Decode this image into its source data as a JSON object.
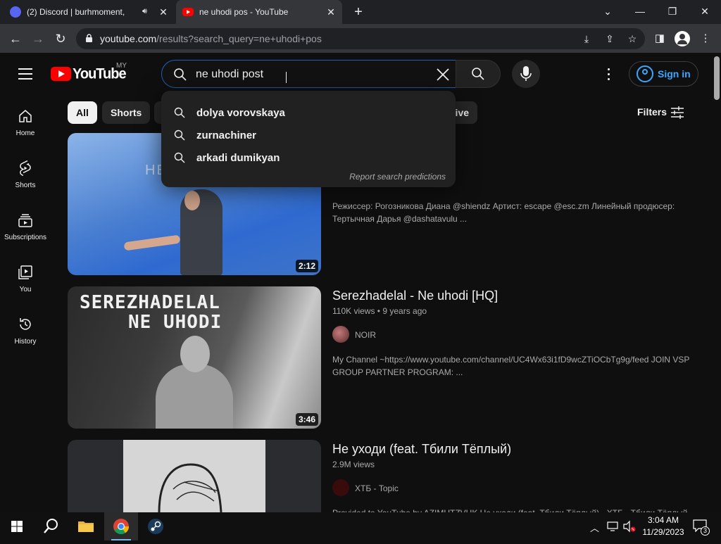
{
  "browser": {
    "tabs": [
      {
        "title": "(2) Discord | burhmoment,",
        "icon": "discord-icon",
        "close": "✕"
      },
      {
        "title": "ne uhodi pos - YouTube",
        "icon": "youtube-icon",
        "close": "✕"
      }
    ],
    "new_tab": "+",
    "window": {
      "list": "⌄",
      "minimize": "—",
      "restore": "❐",
      "close": "✕"
    },
    "url_host": "youtube.com",
    "url_path": "/results?search_query=ne+uhodi+pos"
  },
  "youtube": {
    "logo_text": "YouTube",
    "country": "MY",
    "search_value": "ne uhodi post",
    "sign_in": "Sign in",
    "guide": [
      {
        "label": "Home",
        "icon": "home-icon"
      },
      {
        "label": "Shorts",
        "icon": "shorts-icon"
      },
      {
        "label": "Subscriptions",
        "icon": "subscriptions-icon"
      },
      {
        "label": "You",
        "icon": "you-icon"
      },
      {
        "label": "History",
        "icon": "history-icon"
      }
    ],
    "chips": [
      "All",
      "Shorts",
      "Live"
    ],
    "filters": "Filters",
    "suggestions": [
      "dolya vorovskaya",
      "zurnachiner",
      "arkadi dumikyan"
    ],
    "report": "Report search predictions",
    "results": [
      {
        "thumb_text": "НЕ",
        "duration": "2:12",
        "description_1": "Режиссер: Рогозникова Диана @shiendz Артист: escape @esc.zm Линейный продюсер:",
        "description_2": "Тертычная Дарья @dashatavulu ..."
      },
      {
        "title": "Serezhadelal - Ne uhodi [HQ]",
        "meta": "110K views • 9 years ago",
        "channel": "NOIR",
        "thumb_line1": "SEREZHADELAL",
        "thumb_line2": "NE UHODI",
        "duration": "3:46",
        "description_1": "My Channel ~https://www.youtube.com/channel/UC4Wx63i1fD9wcZTiOCbTg9g/feed JOIN VSP",
        "description_2": "GROUP PARTNER PROGRAM: ..."
      },
      {
        "title": "Не уходи (feat. Тбили Тёплый)",
        "meta": "2.9M views",
        "channel": "ХТБ - Topic",
        "description_1": "Provided to YouTube by AZIMUTZVUK Не уходи (feat. Тбили Тёплый) · ХТБ · Тбили Тёплый"
      }
    ]
  },
  "taskbar": {
    "time": "3:04 AM",
    "date": "11/29/2023",
    "notifications": "3"
  },
  "colors": {
    "accent_blue": "#3ea6ff",
    "youtube_red": "#ff0000",
    "background": "#0f0f0f"
  }
}
